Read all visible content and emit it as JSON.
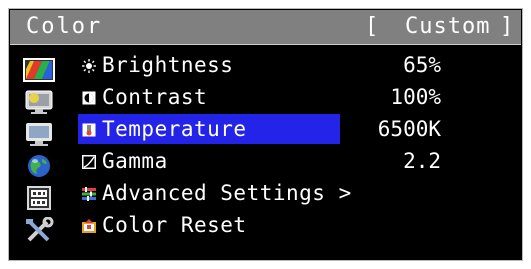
{
  "menu": {
    "title": "Color",
    "mode_left_bracket": "[",
    "mode": "Custom",
    "mode_right_bracket": "]"
  },
  "sidebar": {
    "icons": [
      "color-icon",
      "screen-icon",
      "monitor-settings-icon",
      "globe-icon",
      "abc-123-icon",
      "tools-icon"
    ],
    "selected": "color-icon"
  },
  "items": [
    {
      "icon": "brightness-icon",
      "label": "Brightness",
      "value": "65%"
    },
    {
      "icon": "contrast-icon",
      "label": "Contrast",
      "value": "100%"
    },
    {
      "icon": "temperature-icon",
      "label": "Temperature",
      "value": "6500K",
      "selected": true
    },
    {
      "icon": "gamma-icon",
      "label": "Gamma",
      "value": "2.2"
    },
    {
      "icon": "advanced-settings-icon",
      "label": "Advanced Settings >",
      "value": ""
    },
    {
      "icon": "color-reset-icon",
      "label": "Color Reset",
      "value": ""
    }
  ],
  "colors": {
    "highlight": "#2424e8",
    "titlebar": "#808080",
    "background": "#000000",
    "text": "#ffffff"
  }
}
